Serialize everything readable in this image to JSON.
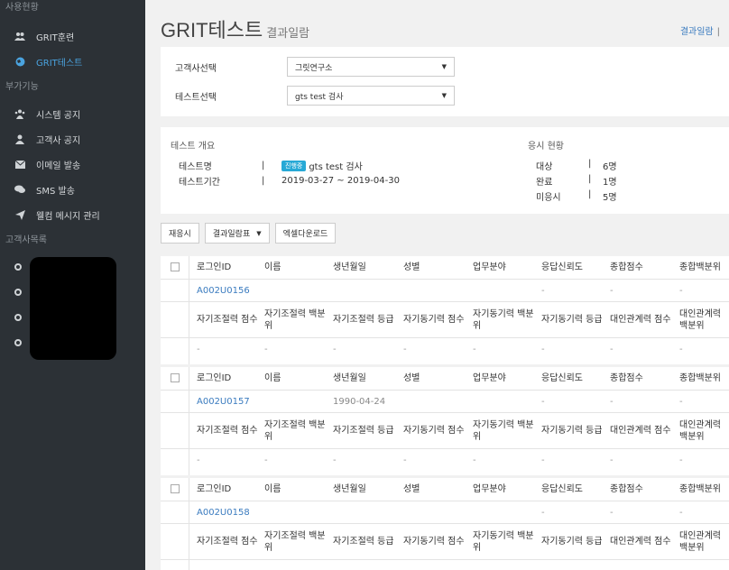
{
  "sidebar": {
    "section_usage": "사용현황",
    "items_usage": [
      {
        "icon": "users-icon",
        "label": "GRIT훈련",
        "active": false
      },
      {
        "icon": "globe-icon",
        "label": "GRIT테스트",
        "active": true
      }
    ],
    "section_addon": "부가기능",
    "items_addon": [
      {
        "icon": "group-icon",
        "label": "시스템 공지"
      },
      {
        "icon": "user-icon",
        "label": "고객사 공지"
      },
      {
        "icon": "envelope-icon",
        "label": "이메일 발송"
      },
      {
        "icon": "comment-icon",
        "label": "SMS 발송"
      },
      {
        "icon": "send-icon",
        "label": "웰컴 메시지 관리"
      }
    ],
    "section_customers": "고객사목록"
  },
  "header": {
    "title": "GRIT테스트",
    "subtitle": "결과일람",
    "top_link": "결과일람",
    "top_sep": "|"
  },
  "filters": {
    "customer_label": "고객사선택",
    "customer_value": "그릿연구소",
    "test_label": "테스트선택",
    "test_value": "gts test 검사"
  },
  "overview": {
    "title": "테스트 개요",
    "name_label": "테스트명",
    "status_badge": "진행중",
    "name_value": "gts test 검사",
    "period_label": "테스트기간",
    "period_value": "2019-03-27 ~ 2019-04-30",
    "sep": "|"
  },
  "status": {
    "title": "응시 현황",
    "rows": [
      {
        "label": "대상",
        "value": "6명"
      },
      {
        "label": "완료",
        "value": "1명"
      },
      {
        "label": "미응시",
        "value": "5명"
      }
    ]
  },
  "toolbar": {
    "resend": "재응시",
    "view_select": "결과일람표",
    "excel": "엑셀다운로드"
  },
  "columns_row1": [
    "로그인ID",
    "이름",
    "생년월일",
    "성별",
    "업무분야",
    "응답신뢰도",
    "종합점수",
    "종합백분위"
  ],
  "columns_row2": [
    "자기조절력 점수",
    "자기조절력 백분위",
    "자기조절력 등급",
    "자기동기력 점수",
    "자기동기력 백분위",
    "자기동기력 등급",
    "대인관계력 점수",
    "대인관계력 백분위"
  ],
  "results": [
    {
      "values1": [
        "A002U0156",
        "",
        "",
        "",
        "",
        "-",
        "-",
        "-"
      ],
      "values2": [
        "-",
        "-",
        "-",
        "-",
        "-",
        "-",
        "-",
        "-"
      ]
    },
    {
      "values1": [
        "A002U0157",
        "",
        "1990-04-24",
        "",
        "",
        "-",
        "-",
        "-"
      ],
      "values2": [
        "-",
        "-",
        "-",
        "-",
        "-",
        "-",
        "-",
        "-"
      ]
    },
    {
      "values1": [
        "A002U0158",
        "",
        "",
        "",
        "",
        "-",
        "-",
        "-"
      ],
      "values2": [
        "-",
        "-",
        "-",
        "-",
        "-",
        "-",
        "-",
        "-"
      ]
    }
  ]
}
